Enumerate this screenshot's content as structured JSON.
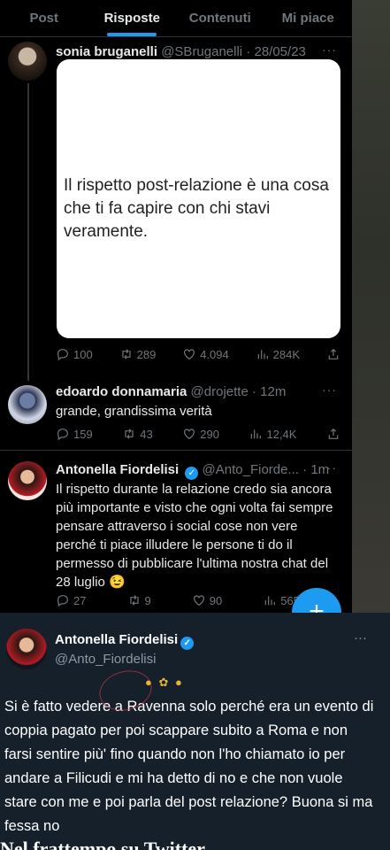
{
  "tabs": [
    "Post",
    "Risposte",
    "Contenuti",
    "Mi piace"
  ],
  "active_tab": "Risposte",
  "posts": [
    {
      "name": "sonia bruganelli",
      "handle": "@SBruganelli",
      "time": "· 28/05/23",
      "image_text": "Il rispetto post-relazione è una cosa che ti fa capire con chi stavi veramente.",
      "replies": "100",
      "reposts": "289",
      "likes": "4.094",
      "views": "284K"
    },
    {
      "name": "edoardo donnamaria",
      "handle": "@drojette",
      "time": "· 12m",
      "text": "grande, grandissima verità",
      "replies": "159",
      "reposts": "43",
      "likes": "290",
      "views": "12,4K"
    },
    {
      "name": "Antonella Fiordelisi",
      "handle": "@Anto_Fiorde...",
      "time": "· 1m",
      "text": "Il rispetto durante la relazione credo sia ancora più importante e visto che ogni volta fai sempre pensare attraverso i social cose non vere perché ti piace illudere le persone ti do il permesso di pubblicare l'ultima nostra chat del 28 luglio 😉",
      "replies": "27",
      "reposts": "9",
      "likes": "90",
      "views": "565"
    }
  ],
  "fab_label": "+",
  "bottom_post": {
    "name": "Antonella Fiordelisi",
    "handle": "@Anto_Fiordelisi",
    "text": "Si è fatto vedere a Ravenna solo perché era un evento di coppia pagato per poi scappare subito a Roma e non farsi sentire più' fino quando non l'ho chiamato io per andare a Filicudi e mi ha detto di no e che non vuole stare con me e poi parla del post relazione? Buona si ma fessa no"
  },
  "more_label": "···",
  "cut_text": "Nel frattempo su Twitter"
}
